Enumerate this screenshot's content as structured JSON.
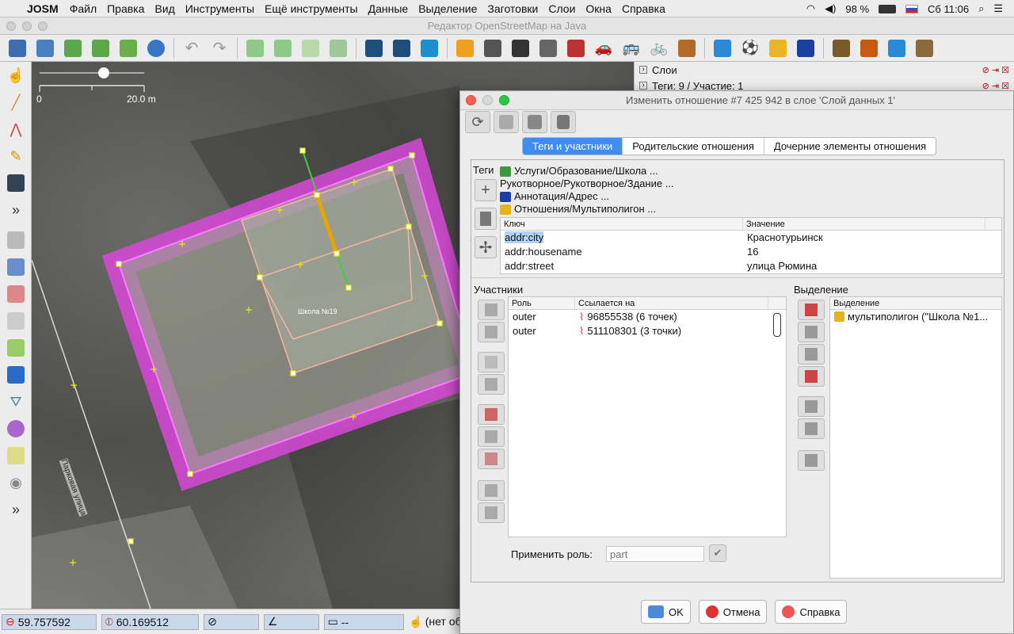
{
  "menubar": {
    "app": "JOSM",
    "items": [
      "Файл",
      "Правка",
      "Вид",
      "Инструменты",
      "Ещё инструменты",
      "Данные",
      "Выделение",
      "Заготовки",
      "Слои",
      "Окна",
      "Справка"
    ],
    "battery": "98 %",
    "clock": "Сб 11:06"
  },
  "window": {
    "title": "Редактор OpenStreetMap на Java"
  },
  "map": {
    "scale_start": "0",
    "scale_end": "20.0 m",
    "label_school": "Школа №19",
    "label_street": "Парковая улица"
  },
  "status": {
    "lat": "59.757592",
    "lon": "60.169512",
    "dist": "--",
    "extra": "(нет об"
  },
  "layers_panel": {
    "title": "Слои",
    "row2": "Теги: 9 / Участие: 1"
  },
  "dialog": {
    "title": "Изменить отношение #7 425 942 в слое 'Слой данных 1'",
    "tabs": [
      "Теги и участники",
      "Родительские отношения",
      "Дочерние элементы отношения"
    ],
    "tags_label": "Теги",
    "presets": [
      {
        "label": "Услуги/Образование/Школа ...",
        "color": "#3a9a3a"
      },
      {
        "label": "Рукотворное/Рукотворное/Здание ...",
        "color": "#ececec"
      },
      {
        "label": "Аннотация/Адрес ...",
        "color": "#1b3fa8"
      },
      {
        "label": "Отношения/Мультиполигон ...",
        "color": "#e8b21a"
      }
    ],
    "tag_table": {
      "headers": [
        "Ключ",
        "Значение"
      ],
      "rows": [
        {
          "key": "addr:city",
          "value": "Краснотурьинск"
        },
        {
          "key": "addr:housename",
          "value": "16"
        },
        {
          "key": "addr:street",
          "value": "улица Рюмина"
        }
      ]
    },
    "members_label": "Участники",
    "members_table": {
      "headers": [
        "Роль",
        "Ссылается на"
      ],
      "rows": [
        {
          "role": "outer",
          "ref": "96855538 (6 точек)"
        },
        {
          "role": "outer",
          "ref": "511108301 (3 точки)"
        }
      ]
    },
    "apply_role_label": "Применить роль:",
    "apply_role_placeholder": "part",
    "selection_label": "Выделение",
    "selection_table": {
      "header": "Выделение",
      "rows": [
        "мультиполигон (\"Школа №1..."
      ]
    },
    "buttons": {
      "ok": "OK",
      "cancel": "Отмена",
      "help": "Справка"
    }
  }
}
